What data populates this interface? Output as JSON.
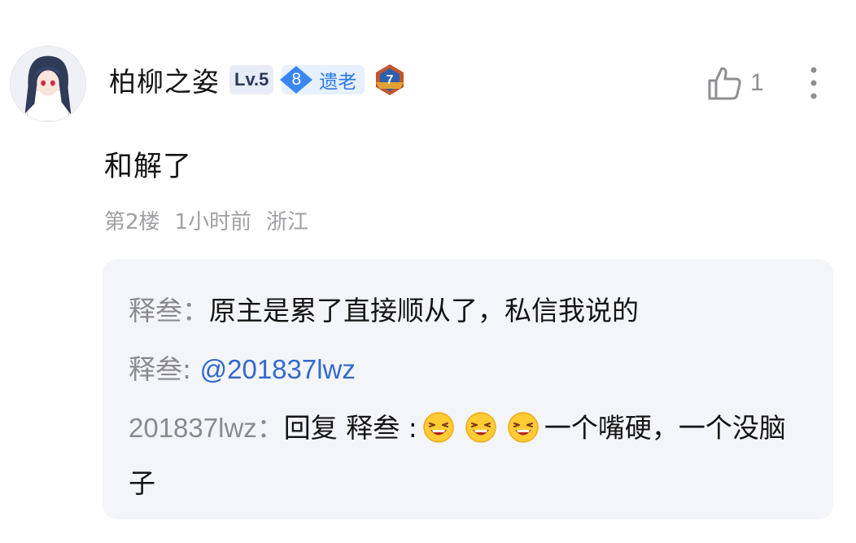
{
  "user": {
    "name": "柏柳之姿",
    "level": "Lv.5",
    "fan_level": "8",
    "fan_badge_name": "遗老",
    "medal": "7"
  },
  "like_count": "1",
  "content": "和解了",
  "meta": {
    "floor": "第2楼",
    "time": "1小时前",
    "location": "浙江"
  },
  "replies": [
    {
      "author": "释叁",
      "separator": "：",
      "text": "原主是累了直接顺从了，私信我说的"
    },
    {
      "author": "释叁",
      "separator": ": ",
      "text": "@201837lwz"
    },
    {
      "author": "201837lwz",
      "separator": "：",
      "prefix": "回复 释叁 :",
      "emoji_count": 3,
      "text": "一个嘴硬，一个没脑子"
    }
  ],
  "icons": [
    "avatar",
    "medal-icon",
    "thumb-up-icon",
    "more-vertical-icon",
    "laughing-emoji-icon"
  ],
  "colors": {
    "accent_blue": "#3369cc",
    "fan_badge_blue": "#2a78e8",
    "reply_bg": "#f4f5f8",
    "muted_text": "#a0a0a5"
  }
}
